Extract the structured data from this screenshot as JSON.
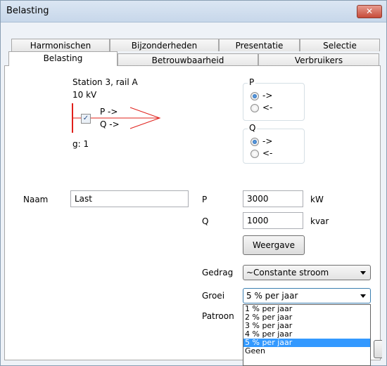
{
  "window": {
    "title": "Belasting",
    "close_glyph": "✕"
  },
  "tabs_row1": [
    "Harmonischen",
    "Bijzonderheden",
    "Presentatie",
    "Selectie"
  ],
  "tabs_row2": [
    "Belasting",
    "Betrouwbaarheid",
    "Verbruikers"
  ],
  "active_tab": "Belasting",
  "diagram": {
    "station": "Station 3, rail A",
    "voltage": "10 kV",
    "p_arrow": "P ->",
    "q_arrow": "Q ->",
    "g_label": "g: 1",
    "checkbox_checked": true,
    "line_color": "#e0201b"
  },
  "p_group": {
    "label": "P",
    "options": [
      "->",
      "<-"
    ],
    "selected": 0
  },
  "q_group": {
    "label": "Q",
    "options": [
      "->",
      "<-"
    ],
    "selected": 0
  },
  "form": {
    "naam_label": "Naam",
    "naam_value": "Last",
    "p_label": "P",
    "p_value": "3000",
    "p_unit": "kW",
    "q_label": "Q",
    "q_value": "1000",
    "q_unit": "kvar",
    "weergave_button": "Weergave",
    "gedrag_label": "Gedrag",
    "gedrag_value": "~Constante stroom",
    "groei_label": "Groei",
    "groei_value": "5 % per jaar",
    "patroon_label": "Patroon"
  },
  "groei_options": [
    "1 % per jaar",
    "2 % per jaar",
    "3 % per jaar",
    "4 % per jaar",
    "5 % per jaar",
    "Geen"
  ],
  "groei_selected_index": 4
}
